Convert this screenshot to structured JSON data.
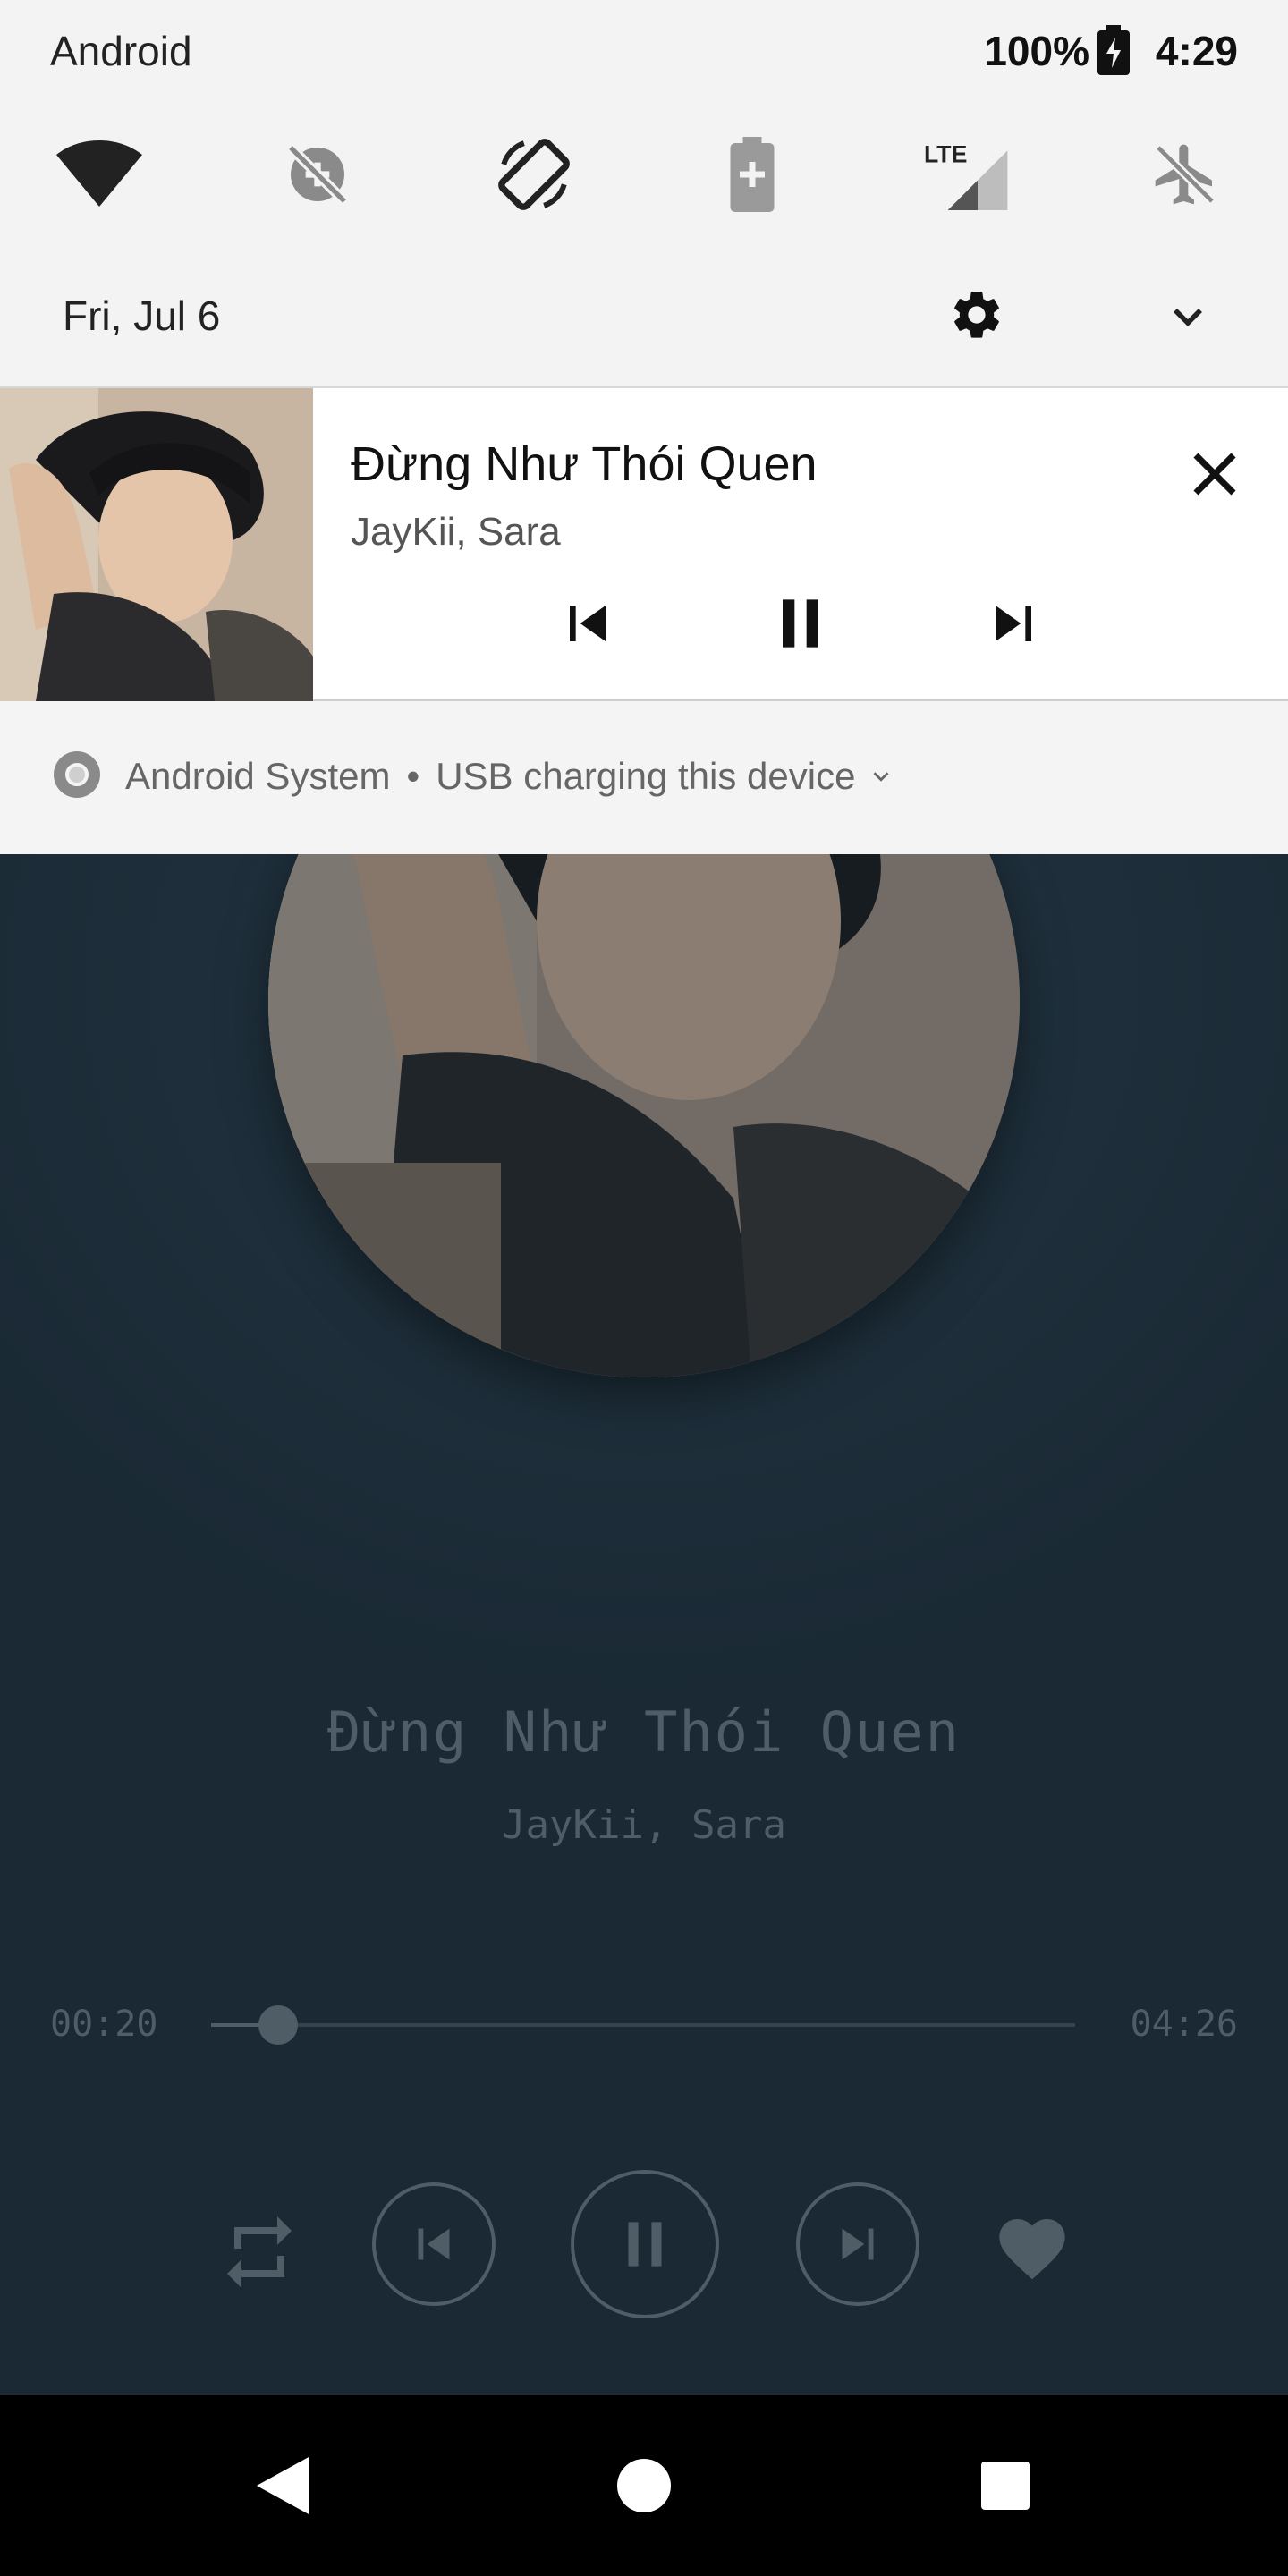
{
  "status_bar": {
    "carrier": "Android",
    "battery_percent": "100%",
    "time": "4:29"
  },
  "quick_settings": {
    "tiles": [
      "wifi-icon",
      "data-saver-off-icon",
      "auto-rotate-icon",
      "battery-saver-icon",
      "lte-signal-icon",
      "airplane-mode-icon"
    ],
    "date": "Fri, Jul 6"
  },
  "media_notification": {
    "title": "Đừng Như Thói Quen",
    "artist": "JayKii, Sara"
  },
  "system_notification": {
    "app": "Android System",
    "message": "USB charging this device"
  },
  "player": {
    "title": "Đừng Như Thói Quen",
    "artist": "JayKii, Sara",
    "elapsed": "00:20",
    "duration": "04:26",
    "progress": 0.078
  },
  "colors": {
    "player_bg": "#1e2f3b",
    "player_muted": "#4f5d67",
    "shade_bg": "#f3f3f3"
  }
}
